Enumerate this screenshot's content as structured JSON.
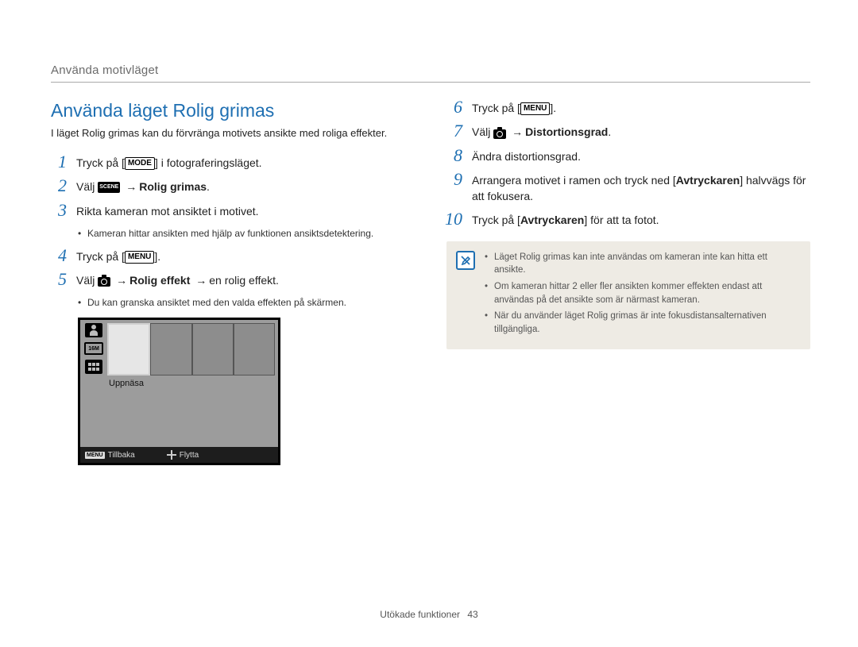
{
  "header": {
    "section_title": "Använda motivläget"
  },
  "title": "Använda läget Rolig grimas",
  "intro": "I läget Rolig grimas kan du förvränga motivets ansikte med roliga effekter.",
  "icons": {
    "mode_label": "MODE",
    "menu_label": "MENU",
    "scene_label": "SCENE"
  },
  "left_steps": [
    {
      "num": "1",
      "parts": [
        {
          "t": "text",
          "v": "Tryck på ["
        },
        {
          "t": "icon",
          "v": "mode"
        },
        {
          "t": "text",
          "v": "] i fotograferingsläget."
        }
      ]
    },
    {
      "num": "2",
      "parts": [
        {
          "t": "text",
          "v": "Välj "
        },
        {
          "t": "icon",
          "v": "scene"
        },
        {
          "t": "text",
          "v": " "
        },
        {
          "t": "arrow"
        },
        {
          "t": "bold",
          "v": "Rolig grimas"
        },
        {
          "t": "text",
          "v": "."
        }
      ]
    },
    {
      "num": "3",
      "parts": [
        {
          "t": "text",
          "v": "Rikta kameran mot ansiktet i motivet."
        }
      ],
      "sub": [
        "Kameran hittar ansikten med hjälp av funktionen ansiktsdetektering."
      ]
    },
    {
      "num": "4",
      "parts": [
        {
          "t": "text",
          "v": "Tryck på ["
        },
        {
          "t": "icon",
          "v": "menu"
        },
        {
          "t": "text",
          "v": "]."
        }
      ]
    },
    {
      "num": "5",
      "parts": [
        {
          "t": "text",
          "v": "Välj "
        },
        {
          "t": "icon",
          "v": "camera"
        },
        {
          "t": "text",
          "v": " "
        },
        {
          "t": "arrow"
        },
        {
          "t": "bold",
          "v": "Rolig effekt"
        },
        {
          "t": "text",
          "v": " "
        },
        {
          "t": "arrow"
        },
        {
          "t": "text",
          "v": "en rolig effekt."
        }
      ],
      "sub": [
        "Du kan granska ansiktet med den valda effekten på skärmen."
      ]
    }
  ],
  "right_steps": [
    {
      "num": "6",
      "parts": [
        {
          "t": "text",
          "v": "Tryck på ["
        },
        {
          "t": "icon",
          "v": "menu"
        },
        {
          "t": "text",
          "v": "]."
        }
      ]
    },
    {
      "num": "7",
      "parts": [
        {
          "t": "text",
          "v": "Välj "
        },
        {
          "t": "icon",
          "v": "camera"
        },
        {
          "t": "text",
          "v": " "
        },
        {
          "t": "arrow"
        },
        {
          "t": "bold",
          "v": "Distortionsgrad"
        },
        {
          "t": "text",
          "v": "."
        }
      ]
    },
    {
      "num": "8",
      "parts": [
        {
          "t": "text",
          "v": "Ändra distortionsgrad."
        }
      ]
    },
    {
      "num": "9",
      "parts": [
        {
          "t": "text",
          "v": "Arrangera motivet i ramen och tryck ned ["
        },
        {
          "t": "bold",
          "v": "Avtryckaren"
        },
        {
          "t": "text",
          "v": "] halvvägs för att fokusera."
        }
      ]
    },
    {
      "num": "10",
      "wide": true,
      "parts": [
        {
          "t": "text",
          "v": "Tryck på ["
        },
        {
          "t": "bold",
          "v": "Avtryckaren"
        },
        {
          "t": "text",
          "v": "] för att ta fotot."
        }
      ]
    }
  ],
  "lcd": {
    "resolution_label": "16M",
    "effect_label": "Uppnäsa",
    "back_label": "Tillbaka",
    "move_label": "Flytta",
    "menu_chip": "MENU"
  },
  "notes": [
    "Läget Rolig grimas kan inte användas om kameran inte kan hitta ett ansikte.",
    "Om kameran hittar 2 eller fler ansikten kommer effekten endast att användas på det ansikte som är närmast kameran.",
    "När du använder läget Rolig grimas är inte fokusdistansalternativen tillgängliga."
  ],
  "footer": {
    "label": "Utökade funktioner",
    "page": "43"
  },
  "arrow_glyph": "→"
}
